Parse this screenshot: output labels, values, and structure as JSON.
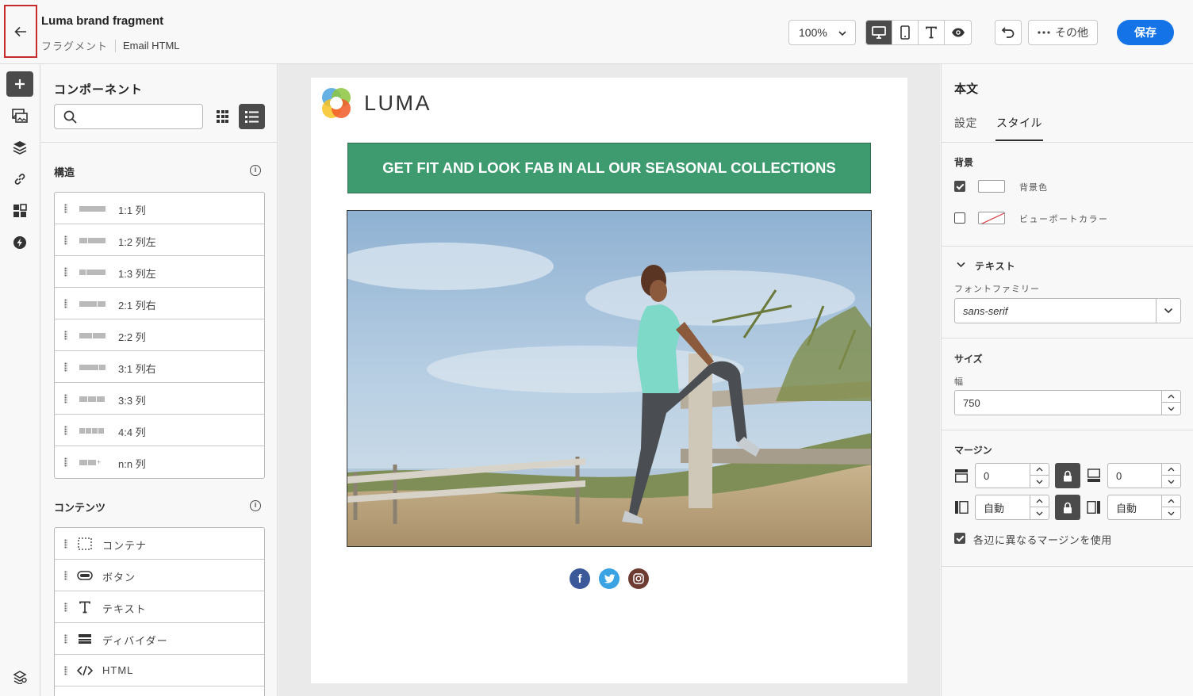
{
  "header": {
    "title": "Luma brand fragment",
    "breadcrumb_type": "フラグメント",
    "breadcrumb_format": "Email HTML",
    "zoom": "100%",
    "more_label": "その他",
    "save_label": "保存"
  },
  "components": {
    "title": "コンポーネント",
    "search_placeholder": "",
    "structure_heading": "構造",
    "structures": [
      {
        "label": "1:1 列"
      },
      {
        "label": "1:2 列左"
      },
      {
        "label": "1:3 列左"
      },
      {
        "label": "2:1 列右"
      },
      {
        "label": "2:2 列"
      },
      {
        "label": "3:1 列右"
      },
      {
        "label": "3:3 列"
      },
      {
        "label": "4:4 列"
      },
      {
        "label": "n:n 列"
      }
    ],
    "content_heading": "コンテンツ",
    "contents": [
      {
        "label": "コンテナ",
        "icon": "container-icon"
      },
      {
        "label": "ボタン",
        "icon": "button-icon"
      },
      {
        "label": "テキスト",
        "icon": "text-icon"
      },
      {
        "label": "ディバイダー",
        "icon": "divider-icon"
      },
      {
        "label": "HTML",
        "icon": "code-icon"
      }
    ]
  },
  "email": {
    "logo_text": "LUMA",
    "banner_text": "GET FIT AND LOOK FAB IN ALL OUR SEASONAL COLLECTIONS",
    "banner_color": "#3d9b6f",
    "socials": [
      "facebook-icon",
      "twitter-icon",
      "instagram-icon"
    ]
  },
  "properties": {
    "title": "本文",
    "tabs": [
      {
        "label": "設定"
      },
      {
        "label": "スタイル"
      }
    ],
    "background_heading": "背景",
    "bg_color_label": "背景色",
    "bg_color_checked": true,
    "viewport_color_label": "ビューポートカラー",
    "viewport_color_checked": false,
    "text_heading": "テキスト",
    "font_family_label": "フォントファミリー",
    "font_family_value": "sans-serif",
    "size_heading": "サイズ",
    "width_label": "幅",
    "width_value": "750",
    "margin_heading": "マージン",
    "margin_top": "0",
    "margin_bottom": "0",
    "margin_left": "自動",
    "margin_right": "自動",
    "different_margins_label": "各辺に異なるマージンを使用",
    "different_margins_checked": true
  }
}
